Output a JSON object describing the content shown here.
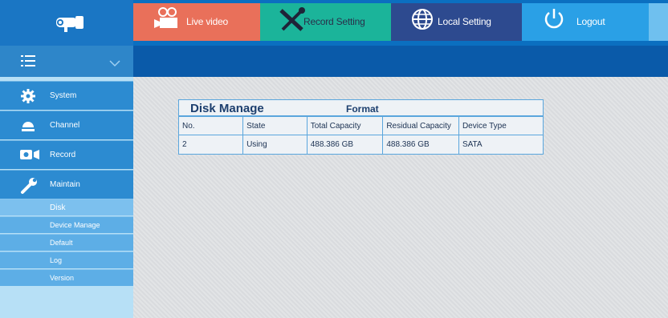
{
  "header": {
    "logo_icon": "camera-logo-icon",
    "tabs": [
      {
        "label": "Live video",
        "icon": "live-video-icon",
        "color": "#e9705a"
      },
      {
        "label": "Record Setting",
        "icon": "tools-icon",
        "color": "#1bb49a"
      },
      {
        "label": "Local Setting",
        "icon": "globe-icon",
        "color": "#2d4a8f"
      },
      {
        "label": "Logout",
        "icon": "power-icon",
        "color": "#2aa0e6"
      }
    ]
  },
  "sidebar": {
    "toggle_icon": "menu-icon",
    "collapse_icon": "chevron-down-icon",
    "items": [
      {
        "label": "System",
        "icon": "gear-icon"
      },
      {
        "label": "Channel",
        "icon": "dome-camera-icon"
      },
      {
        "label": "Record",
        "icon": "record-icon"
      },
      {
        "label": "Maintain",
        "icon": "wrench-icon"
      }
    ],
    "subitems": [
      {
        "label": "Disk",
        "active": true
      },
      {
        "label": "Device Manage",
        "active": false
      },
      {
        "label": "Default",
        "active": false
      },
      {
        "label": "Log",
        "active": false
      },
      {
        "label": "Version",
        "active": false
      }
    ]
  },
  "disk_panel": {
    "title": "Disk Manage",
    "format_label": "Format",
    "columns": [
      "No.",
      "State",
      "Total Capacity",
      "Residual Capacity",
      "Device Type"
    ],
    "rows": [
      [
        "2",
        "Using",
        "488.386 GB",
        "488.386 GB",
        "SATA"
      ]
    ]
  }
}
